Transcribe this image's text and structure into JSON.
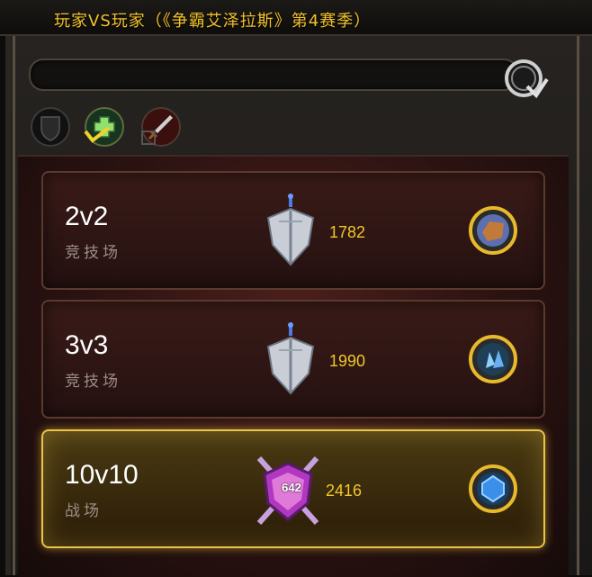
{
  "window": {
    "title": "玩家VS玩家（《争霸艾泽拉斯》第4赛季）"
  },
  "search": {
    "value": "",
    "placeholder": ""
  },
  "filters": [
    {
      "icon": "shield-icon"
    },
    {
      "icon": "healer-cross-icon",
      "checked": true
    },
    {
      "icon": "dps-sword-icon"
    }
  ],
  "brackets": [
    {
      "mode": "2v2",
      "type": "竞技场",
      "rating": "1782",
      "emblem": "arena-sword-emblem-icon",
      "reward": "reward-chest-icon"
    },
    {
      "mode": "3v3",
      "type": "竞技场",
      "rating": "1990",
      "emblem": "arena-sword-emblem-icon",
      "reward": "reward-crystals-icon"
    },
    {
      "mode": "10v10",
      "type": "战场",
      "rating": "2416",
      "emblem": "battleground-rank-emblem-icon",
      "emblem_number": "642",
      "reward": "reward-gem-icon",
      "selected": true
    }
  ],
  "colors": {
    "title": "#f2c22b",
    "rating": "#f1c72a",
    "selected_border": "#e8c448"
  }
}
